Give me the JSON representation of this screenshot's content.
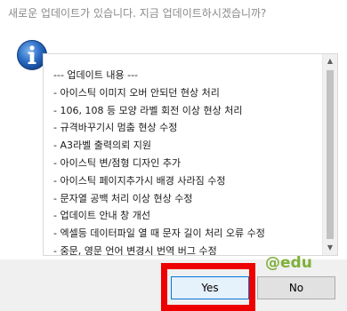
{
  "dialog": {
    "title": "새로운 업데이트가 있습니다. 지금 업데이트하시겠습니까?",
    "icon": "info-icon",
    "content_lines": [
      "--- 업데이트 내용 ---",
      "- 아이스틱 이미지 오버 안되던 현상 처리",
      "- 106, 108 등 모양 라벨 회전 이상 현상 처리",
      "- 규격바꾸기시 멈춤 현상 수정",
      "- A3라벨 출력의뢰 지원",
      "- 아이스틱 변/점형 디자인 추가",
      "- 아이스틱 페이지추가시 배경 사라짐 수정",
      "- 문자열 공백 처리 이상 현상 수정",
      "- 업데이트 안내 창 개선",
      "- 엑셀등 데이터파일 열 때 문자 길이 처리 오류 수정",
      "- 중문, 영문 언어 변경시 번역 버그 수정"
    ],
    "yes_label": "Yes",
    "no_label": "No"
  },
  "watermark": "@edu",
  "colors": {
    "highlight": "#ee0000",
    "watermark": "#7fb03a",
    "icon_blue": "#1f5fb8"
  }
}
